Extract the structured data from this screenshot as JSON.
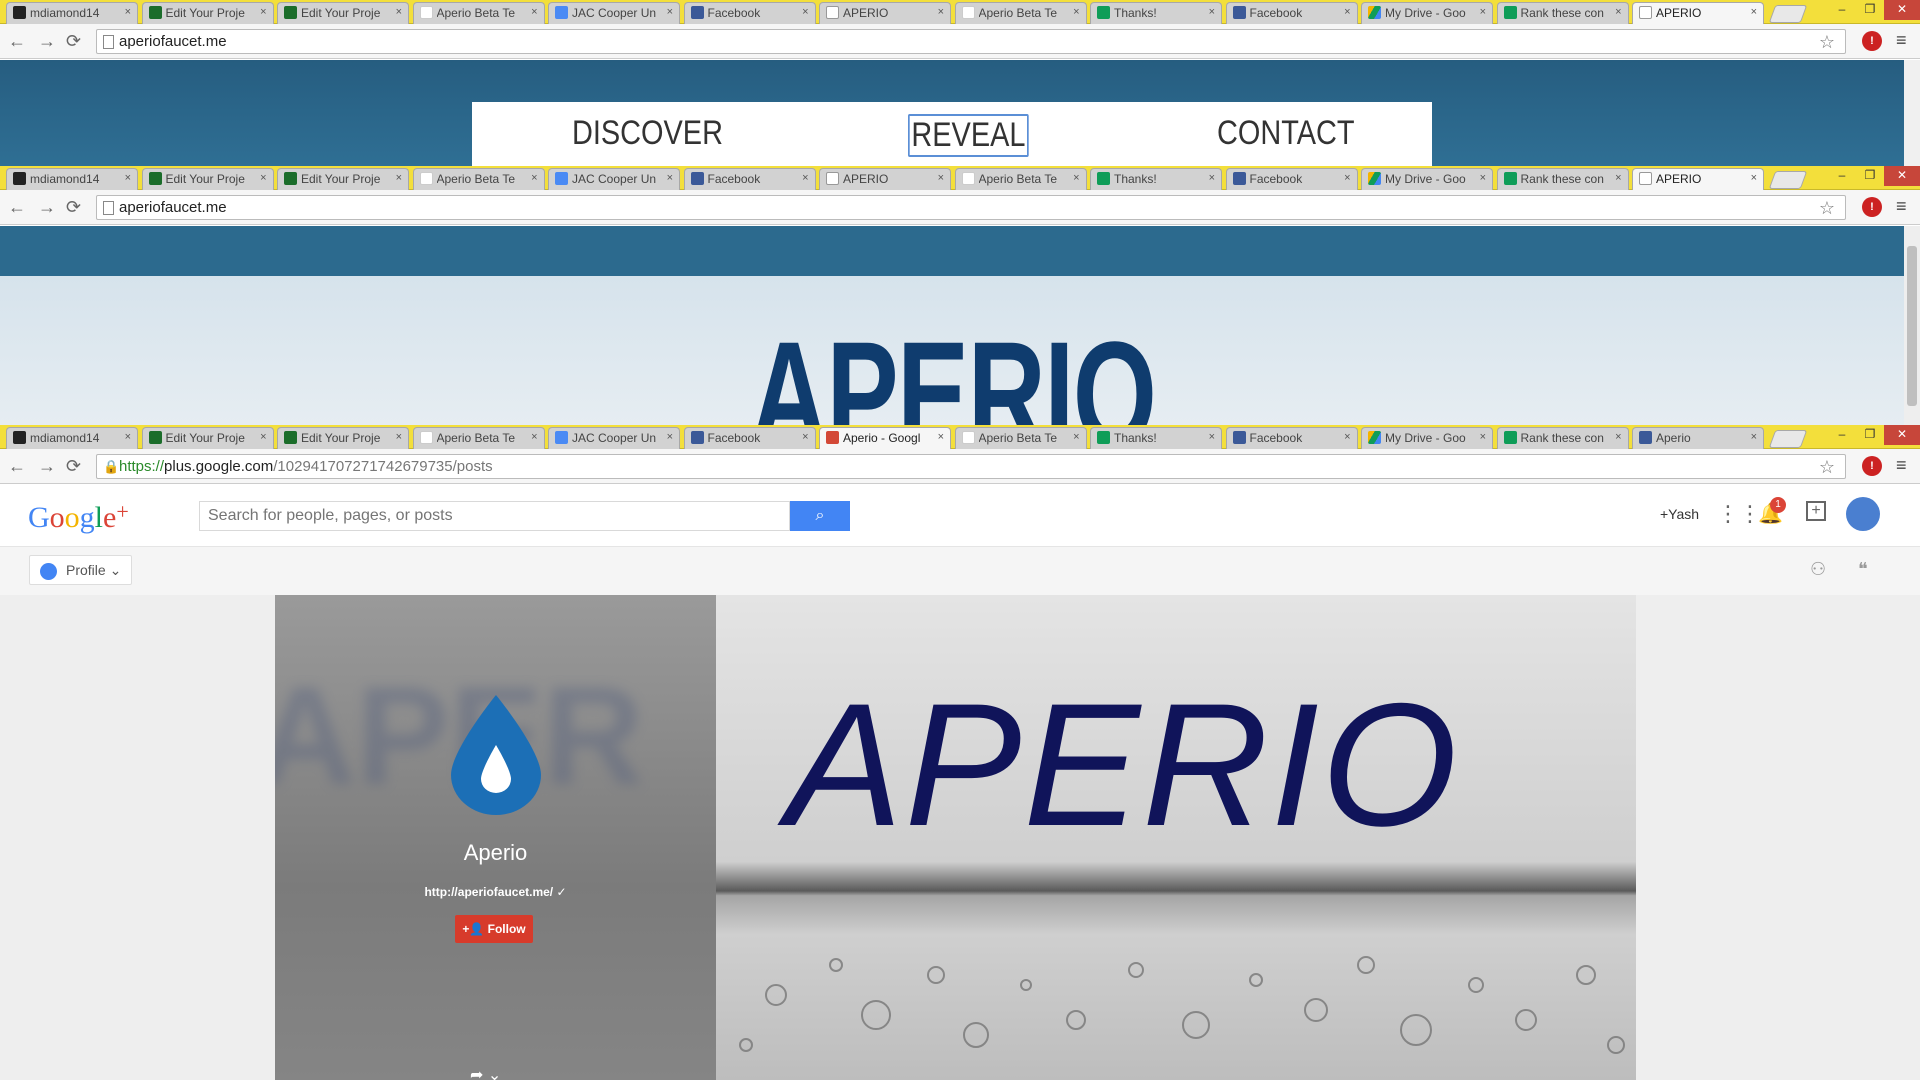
{
  "tabs_w1": [
    {
      "icon": "github-icon",
      "cls": "fav-github",
      "label": "mdiamond14"
    },
    {
      "icon": "k-icon",
      "cls": "fav-k",
      "label": "Edit Your Proje"
    },
    {
      "icon": "k-icon",
      "cls": "fav-k",
      "label": "Edit Your Proje"
    },
    {
      "icon": "gmail-icon",
      "cls": "fav-gmail",
      "label": "Aperio Beta Te"
    },
    {
      "icon": "adwords-icon",
      "cls": "fav-ads",
      "label": "JAC Cooper Un"
    },
    {
      "icon": "facebook-icon",
      "cls": "fav-fb",
      "label": "Facebook"
    },
    {
      "icon": "page-icon",
      "cls": "fav-doc",
      "label": "APERIO"
    },
    {
      "icon": "gmail-icon",
      "cls": "fav-gmail",
      "label": "Aperio Beta Te"
    },
    {
      "icon": "forms-icon",
      "cls": "fav-sheet",
      "label": "Thanks!"
    },
    {
      "icon": "facebook-icon",
      "cls": "fav-fb",
      "label": "Facebook"
    },
    {
      "icon": "drive-icon",
      "cls": "fav-drive",
      "label": "My Drive - Goo"
    },
    {
      "icon": "sheets-icon",
      "cls": "fav-sheet",
      "label": "Rank these con"
    },
    {
      "icon": "page-icon",
      "cls": "fav-doc",
      "label": "APERIO",
      "active": true
    }
  ],
  "tabs_w3": [
    {
      "icon": "github-icon",
      "cls": "fav-github",
      "label": "mdiamond14"
    },
    {
      "icon": "k-icon",
      "cls": "fav-k",
      "label": "Edit Your Proje"
    },
    {
      "icon": "k-icon",
      "cls": "fav-k",
      "label": "Edit Your Proje"
    },
    {
      "icon": "gmail-icon",
      "cls": "fav-gmail",
      "label": "Aperio Beta Te"
    },
    {
      "icon": "adwords-icon",
      "cls": "fav-ads",
      "label": "JAC Cooper Un"
    },
    {
      "icon": "facebook-icon",
      "cls": "fav-fb",
      "label": "Facebook"
    },
    {
      "icon": "gplus-icon",
      "cls": "fav-gplus",
      "label": "Aperio - Googl",
      "active": true
    },
    {
      "icon": "gmail-icon",
      "cls": "fav-gmail",
      "label": "Aperio Beta Te"
    },
    {
      "icon": "forms-icon",
      "cls": "fav-sheet",
      "label": "Thanks!"
    },
    {
      "icon": "facebook-icon",
      "cls": "fav-fb",
      "label": "Facebook"
    },
    {
      "icon": "drive-icon",
      "cls": "fav-drive",
      "label": "My Drive - Goo"
    },
    {
      "icon": "sheets-icon",
      "cls": "fav-sheet",
      "label": "Rank these con"
    },
    {
      "icon": "facebook-icon",
      "cls": "fav-fb",
      "label": "Aperio"
    }
  ],
  "window1": {
    "url": "aperiofaucet.me",
    "nav": {
      "discover": "DISCOVER",
      "reveal": "REVEAL",
      "contact": "CONTACT"
    }
  },
  "window2": {
    "url": "aperiofaucet.me",
    "hero_title": "APERIO"
  },
  "window3": {
    "url_scheme": "https://",
    "url_host": "plus.google.com",
    "url_path": "/102941707271742679735/posts",
    "logo": {
      "g1": "G",
      "o1": "o",
      "o2": "o",
      "g2": "g",
      "l": "l",
      "e": "e",
      "plus": "+"
    },
    "search_placeholder": "Search for people, pages, or posts",
    "user_link": "+Yash",
    "notification_count": "1",
    "profile_label": "Profile",
    "page_name": "Aperio",
    "page_url": "http://aperiofaucet.me/",
    "follow_label": "Follow",
    "cover_text": "APERIO"
  },
  "colors": {
    "tabstrip": "#f3df3b",
    "site_blue": "#265d80",
    "hero_text": "#0f3c6e",
    "google_blue": "#4285f4",
    "follow_red": "#d73b2b",
    "cover_text": "#10145a"
  }
}
